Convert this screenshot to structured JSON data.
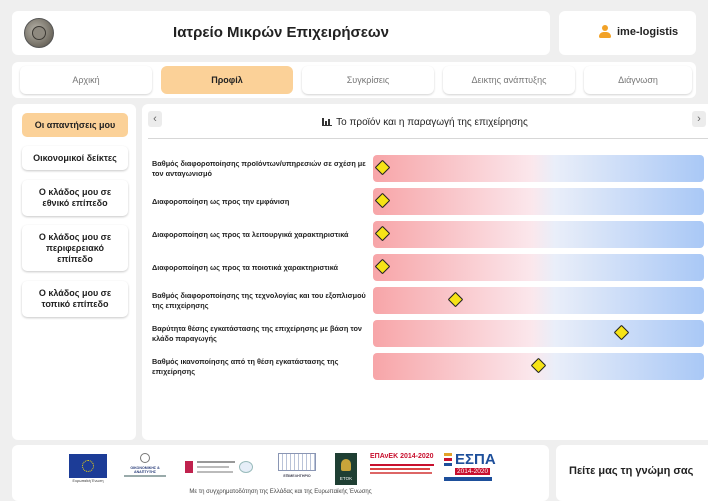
{
  "header": {
    "title": "Ιατρείο Μικρών Επιχειρήσεων",
    "logo_icon": "coin-logo-icon"
  },
  "user": {
    "name": "ime-logistis",
    "icon": "user-icon",
    "icon_color": "#f2a227"
  },
  "tabs": [
    {
      "label": "Αρχική",
      "active": false
    },
    {
      "label": "Προφίλ",
      "active": true
    },
    {
      "label": "Συγκρίσεις",
      "active": false
    },
    {
      "label": "Δεικτης ανάπτυξης",
      "active": false
    },
    {
      "label": "Διάγνωση",
      "active": false
    }
  ],
  "sidebar": {
    "items": [
      {
        "label": "Οι απαντήσεις μου",
        "active": true
      },
      {
        "label": "Οικονομικοί δείκτες",
        "active": false
      },
      {
        "label": "Ο κλάδος μου σε εθνικό επίπεδο",
        "active": false
      },
      {
        "label": "Ο κλάδος μου σε περιφερειακό επίπεδο",
        "active": false
      },
      {
        "label": "Ο κλάδος μου σε τοπικό επίπεδο",
        "active": false
      }
    ]
  },
  "section": {
    "title": "Το προϊόν και η παραγωγή της επιχείρησης",
    "title_icon": "bar-chart-icon",
    "prev_label": "‹",
    "next_label": "›"
  },
  "ratings": [
    {
      "label": "Βαθμός διαφοροποίησης προϊόντων/υπηρεσιών σε σχέση με τον ανταγωνισμό",
      "value": 0.03
    },
    {
      "label": "Διαφοροποίηση ως προς την εμφάνιση",
      "value": 0.03
    },
    {
      "label": "Διαφοροποίηση ως προς τα λειτουργικά χαρακτηριστικά",
      "value": 0.03
    },
    {
      "label": "Διαφοροποίηση ως προς τα ποιοτικά χαρακτηριστικά",
      "value": 0.03
    },
    {
      "label": "Βαθμός διαφοροποίησης της τεχνολογίας και του εξοπλισμού της επιχείρησης",
      "value": 0.25
    },
    {
      "label": "Βαρύτητα θέσης εγκατάστασης της επιχείρησης με βάση τον κλάδο παραγωγής",
      "value": 0.75
    },
    {
      "label": "Βαθμός ικανοποίησης από τη θέση εγκατάστασης της επιχείρησης",
      "value": 0.5
    }
  ],
  "colors": {
    "accent": "#fbd198",
    "marker": "#f6e316",
    "bar_low": "#f7a5a8",
    "bar_high": "#a9c8f6"
  },
  "footer": {
    "funding_text": "Με τη συγχρηματοδότηση της Ελλάδας και της Ευρωπαϊκής Ένωσης",
    "feedback": "Πείτε μας τη γνώμη σας",
    "logos": {
      "eu": "Ευρωπαϊκή Ένωση",
      "ministry": "ΟΙΚΟΝΟΜΙΚΗΣ & ΑΝΑΠΤΥΞΗΣ",
      "chamber": "ΕΠΙΜΕΛΗΤΗΡΙΟ",
      "espa_small": "ΕΤΟΚ",
      "epanek": "ΕΠΑνΕΚ 2014-2020",
      "espa": "ΕΣΠΑ",
      "espa_years": "2014-2020"
    }
  }
}
